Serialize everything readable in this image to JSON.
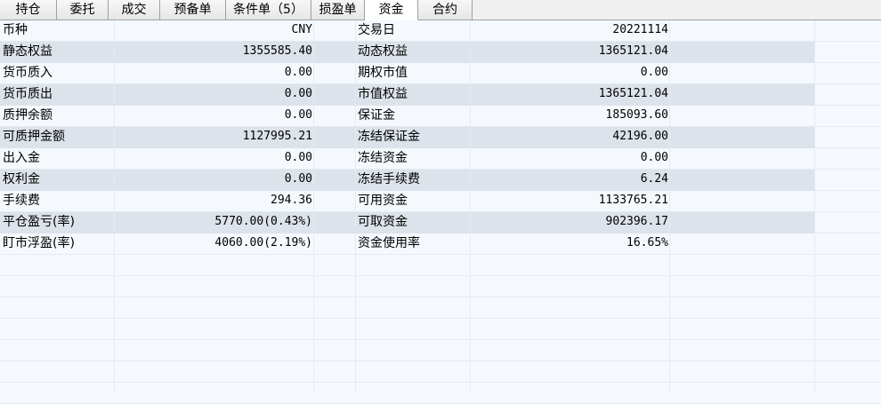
{
  "tabs": [
    {
      "label": "持仓",
      "name": "tab-positions",
      "w": "w64"
    },
    {
      "label": "委托",
      "name": "tab-orders",
      "w": "w58"
    },
    {
      "label": "成交",
      "name": "tab-trades",
      "w": "w58"
    },
    {
      "label": "预备单",
      "name": "tab-prepared-orders",
      "w": "w74"
    },
    {
      "label": "条件单（5）",
      "name": "tab-conditional-orders",
      "w": "w96"
    },
    {
      "label": "损盈单",
      "name": "tab-stop-orders",
      "w": "w60"
    },
    {
      "label": "资金",
      "name": "tab-funds",
      "w": "w60",
      "active": true
    },
    {
      "label": "合约",
      "name": "tab-contracts",
      "w": "w61"
    }
  ],
  "funds": {
    "rows": [
      {
        "k1": "币种",
        "v1": "CNY",
        "k2": "交易日",
        "v2": "20221114"
      },
      {
        "k1": "静态权益",
        "v1": "1355585.40",
        "k2": "动态权益",
        "v2": "1365121.04"
      },
      {
        "k1": "货币质入",
        "v1": "0.00",
        "k2": "期权市值",
        "v2": "0.00"
      },
      {
        "k1": "货币质出",
        "v1": "0.00",
        "k2": "市值权益",
        "v2": "1365121.04"
      },
      {
        "k1": "质押余额",
        "v1": "0.00",
        "k2": "保证金",
        "v2": "185093.60"
      },
      {
        "k1": "可质押金额",
        "v1": "1127995.21",
        "k2": "冻结保证金",
        "v2": "42196.00"
      },
      {
        "k1": "出入金",
        "v1": "0.00",
        "k2": "冻结资金",
        "v2": "0.00"
      },
      {
        "k1": "权利金",
        "v1": "0.00",
        "k2": "冻结手续费",
        "v2": "6.24"
      },
      {
        "k1": "手续费",
        "v1": "294.36",
        "k2": "可用资金",
        "v2": "1133765.21"
      },
      {
        "k1": "平仓盈亏(率)",
        "v1": "5770.00(0.43%)",
        "k2": "可取资金",
        "v2": "902396.17"
      },
      {
        "k1": "盯市浮盈(率)",
        "v1": "4060.00(2.19%)",
        "k2": "资金使用率",
        "v2": "16.65%"
      }
    ]
  }
}
